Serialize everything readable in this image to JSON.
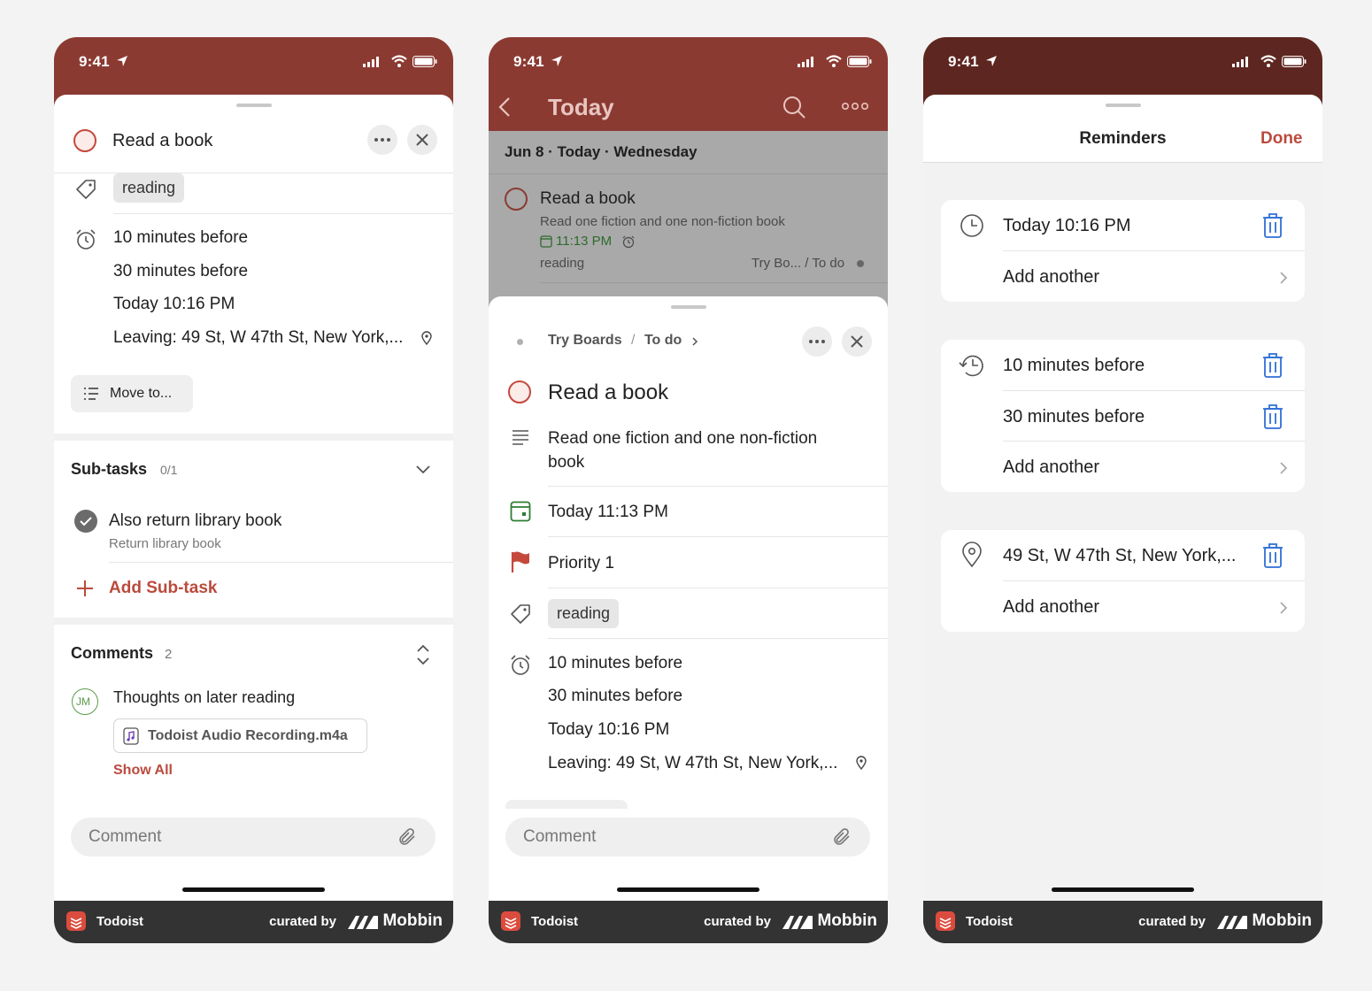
{
  "status": {
    "time": "9:41"
  },
  "footer": {
    "app": "Todoist",
    "curated": "curated by",
    "brand": "Mobbin"
  },
  "screen1": {
    "title": "Read a book",
    "label": "reading",
    "reminders": [
      "10 minutes before",
      "30 minutes before",
      "Today 10:16 PM",
      "Leaving: 49 St, W 47th St, New York,..."
    ],
    "move_button": "Move to...",
    "subtasks_title": "Sub-tasks",
    "subtasks_count": "0/1",
    "subtask_title": "Also return library book",
    "subtask_desc": "Return library book",
    "add_subtask": "Add Sub-task",
    "comments_title": "Comments",
    "comments_count": "2",
    "avatar_initials": "JM",
    "comment_text": "Thoughts on later reading",
    "attachment": "Todoist Audio Recording.m4a",
    "show_all": "Show All",
    "comment_placeholder": "Comment"
  },
  "screen2": {
    "nav_title": "Today",
    "date_header": "Jun 8 · Today · Wednesday",
    "task_title": "Read a book",
    "task_desc": "Read one fiction and one non-fiction book",
    "task_time": "11:13 PM",
    "task_label": "reading",
    "task_project": "Try Bo... / To do",
    "breadcrumb_project": "Try Boards",
    "breadcrumb_section": "To do",
    "detail_title": "Read a book",
    "description": "Read one fiction and one non-fiction book",
    "due": "Today 11:13 PM",
    "priority": "Priority 1",
    "label": "reading",
    "reminders": [
      "10 minutes before",
      "30 minutes before",
      "Today 10:16 PM",
      "Leaving: 49 St, W 47th St, New York,..."
    ],
    "comment_placeholder": "Comment"
  },
  "screen3": {
    "title": "Reminders",
    "done": "Done",
    "time_reminder": "Today 10:16 PM",
    "relative_reminders": [
      "10 minutes before",
      "30 minutes before"
    ],
    "location_reminder": "49 St, W 47th St, New York,...",
    "add_another": "Add another"
  },
  "colors": {
    "brand_red": "#8b3a32",
    "accent": "#b94b3d",
    "footer": "#333333",
    "trash_blue": "#2f6fd6"
  }
}
